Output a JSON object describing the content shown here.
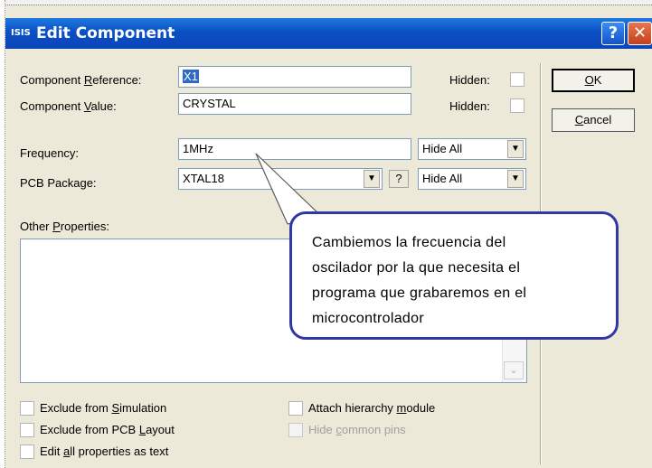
{
  "window": {
    "app_icon": "ISIS",
    "title": "Edit Component",
    "help_glyph": "?",
    "close_glyph": "✕"
  },
  "form": {
    "reference_label": "Component Reference:",
    "reference_value": "X1",
    "value_label": "Component Value:",
    "value_value": "CRYSTAL",
    "hidden_label": "Hidden:",
    "frequency_label": "Frequency:",
    "frequency_value": "1MHz",
    "frequency_visibility": "Hide All",
    "pcb_label": "PCB Package:",
    "pcb_value": "XTAL18",
    "pcb_help": "?",
    "pcb_visibility": "Hide All",
    "other_label": "Other Properties:",
    "other_value": ""
  },
  "buttons": {
    "ok": "OK",
    "cancel": "Cancel"
  },
  "options": {
    "exclude_simulation": "Exclude from Simulation",
    "exclude_pcb": "Exclude from PCB Layout",
    "edit_all_text": "Edit all properties as text",
    "attach_hierarchy": "Attach hierarchy module",
    "hide_common_pins": "Hide common pins"
  },
  "callout": {
    "text": "Cambiemos la frecuencia del\noscilador por la que necesita el\nprograma que grabaremos en el\nmicrocontrolador"
  },
  "icons": {
    "dropdown": "▼",
    "scroll_down": "⌄"
  }
}
